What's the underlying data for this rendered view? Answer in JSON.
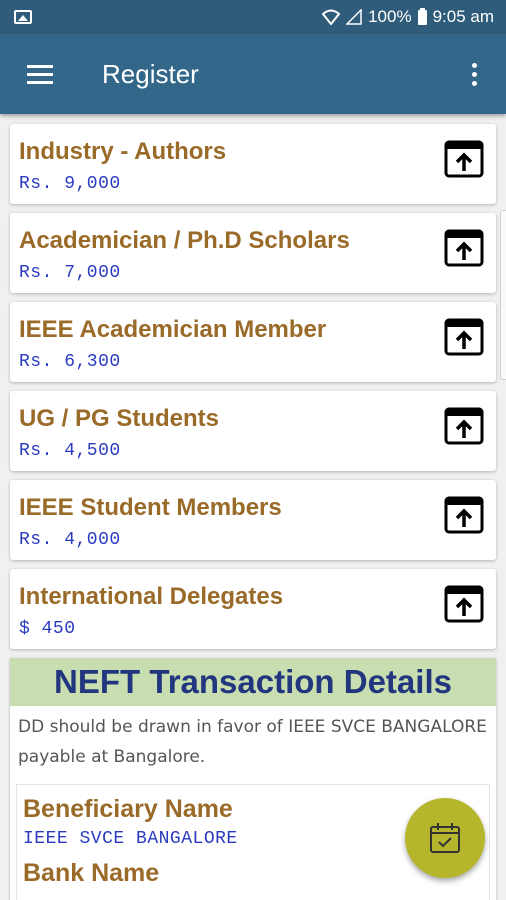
{
  "status_bar": {
    "battery_pct": "100%",
    "time": "9:05 am"
  },
  "app_bar": {
    "title": "Register"
  },
  "categories": [
    {
      "title": "Industry - Authors",
      "price": "Rs. 9,000"
    },
    {
      "title": "Academician / Ph.D Scholars",
      "price": "Rs. 7,000"
    },
    {
      "title": "IEEE Academician Member",
      "price": "Rs. 6,300"
    },
    {
      "title": "UG / PG Students",
      "price": "Rs. 4,500"
    },
    {
      "title": "IEEE Student Members",
      "price": "Rs. 4,000"
    },
    {
      "title": "International Delegates",
      "price": "$ 450"
    }
  ],
  "neft": {
    "title": "NEFT Transaction Details",
    "note": "DD should be drawn in favor of IEEE SVCE BANGALORE payable at Bangalore.",
    "beneficiary_label": "Beneficiary Name",
    "beneficiary_value": "IEEE SVCE BANGALORE",
    "bank_label": "Bank Name"
  },
  "icons": {
    "card_action": "open-in-upload-icon",
    "fab": "calendar-check-icon"
  },
  "colors": {
    "app_bar": "#33678a",
    "status_bar": "#2f5c7a",
    "title_text": "#9a6a29",
    "price_text": "#2b3bbf",
    "neft_header": "#c8ddb0",
    "fab": "#b5b62b"
  }
}
